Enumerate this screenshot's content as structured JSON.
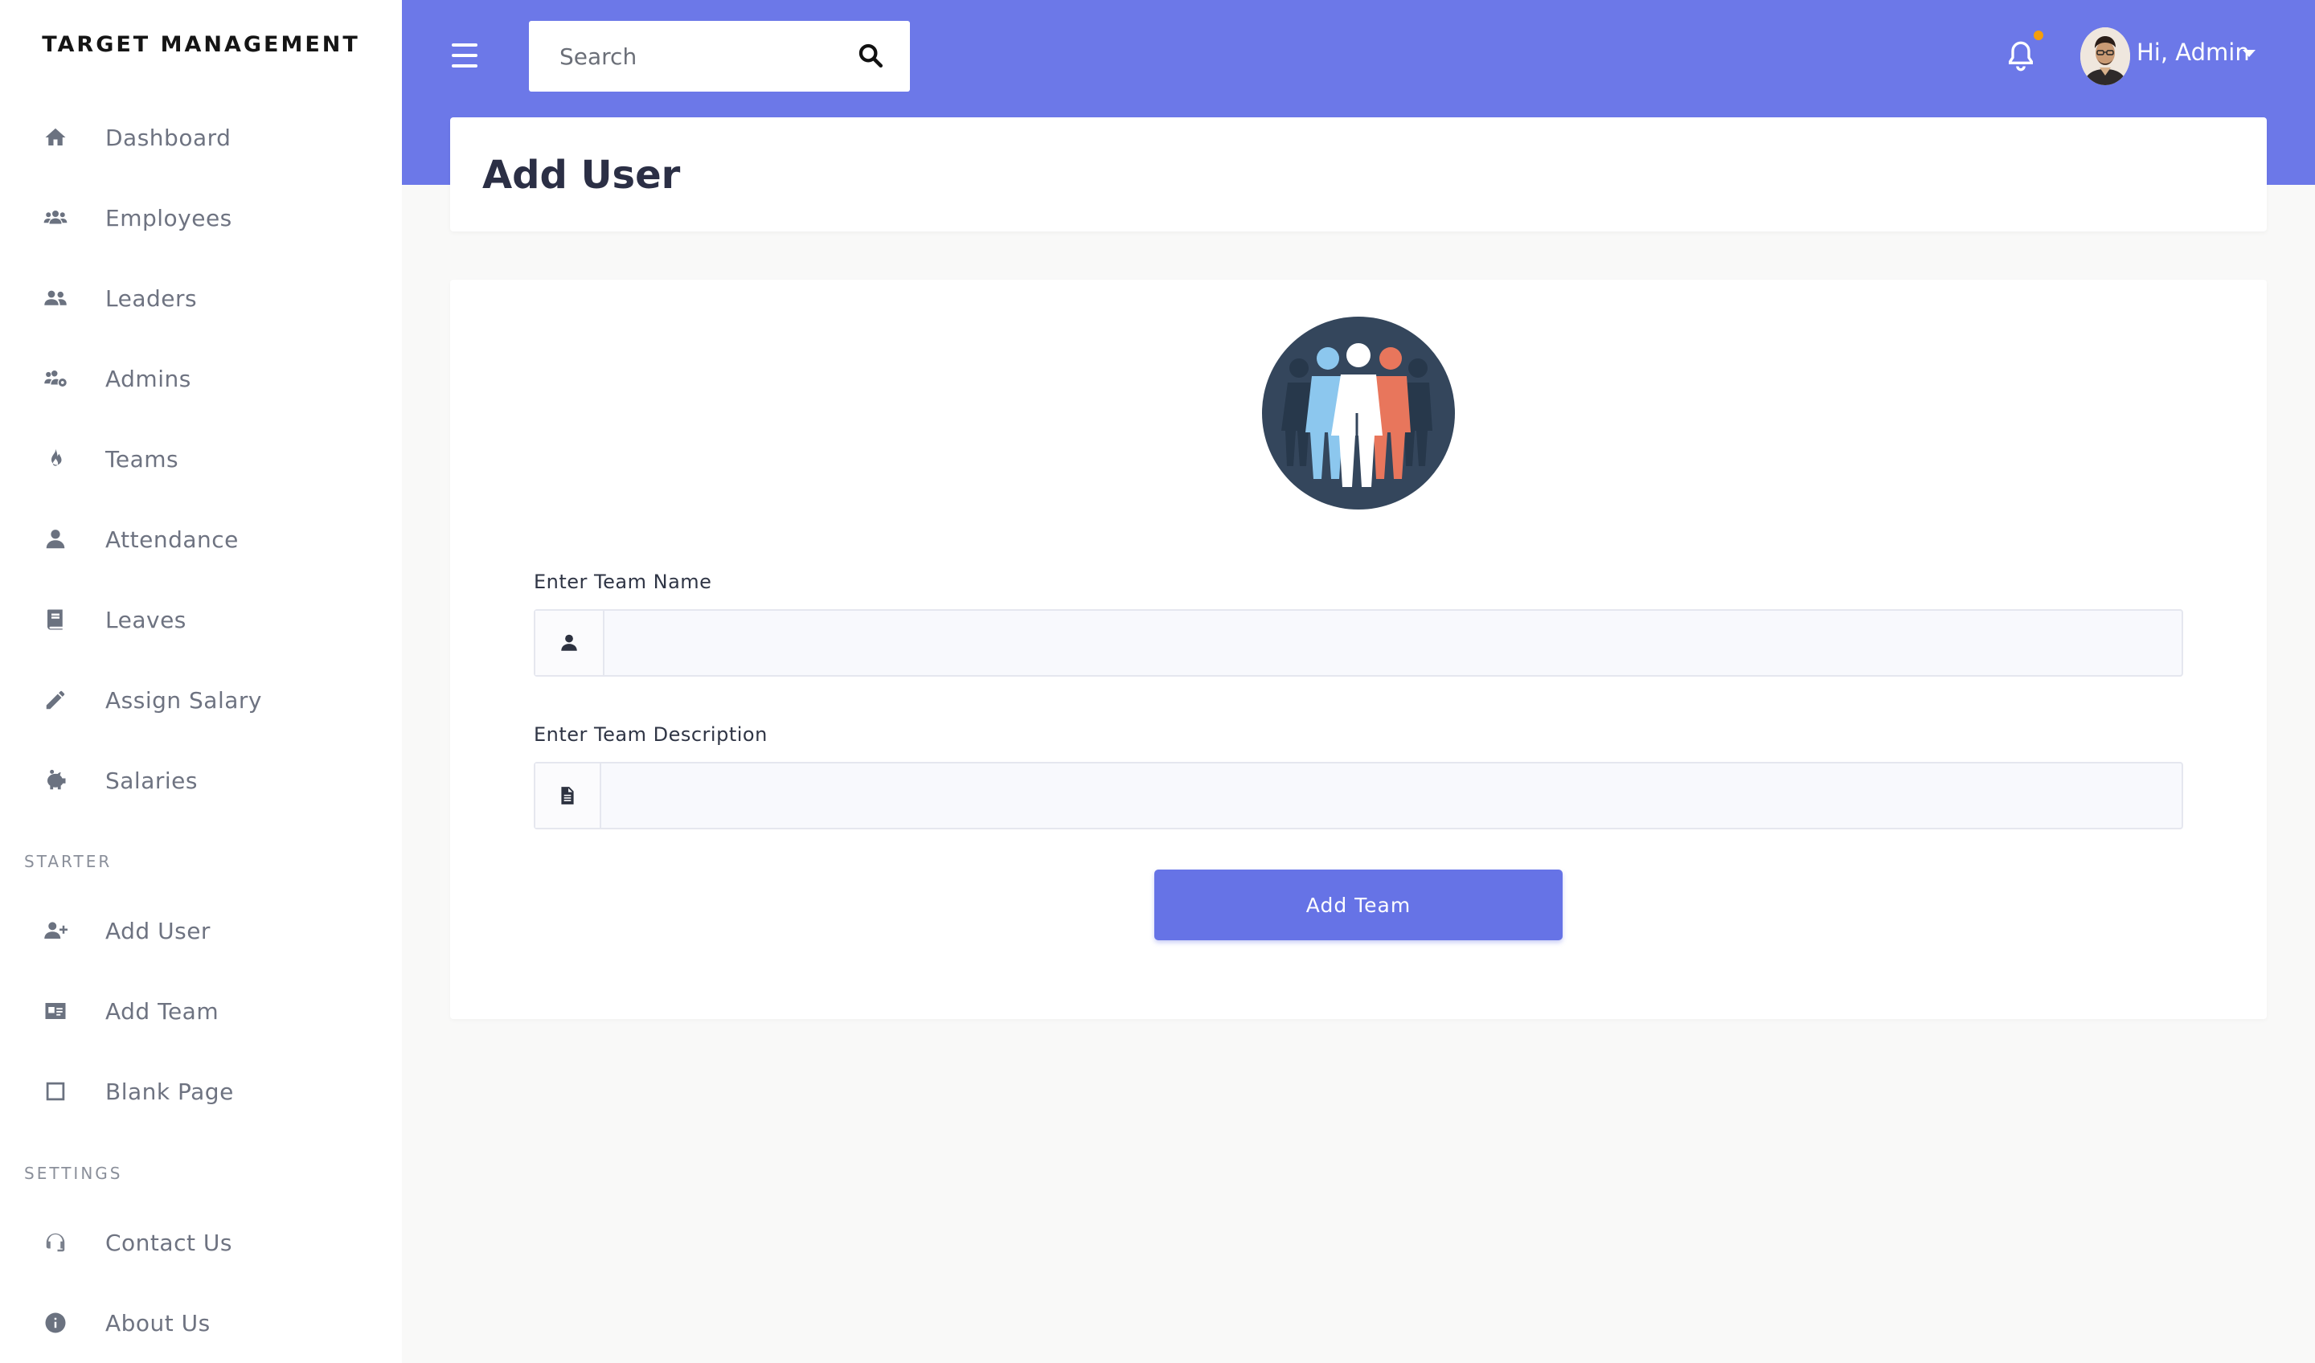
{
  "sidebar": {
    "brand": "TARGET MANAGEMENT",
    "items": [
      {
        "label": "Dashboard",
        "icon": "home-icon"
      },
      {
        "label": "Employees",
        "icon": "users-icon"
      },
      {
        "label": "Leaders",
        "icon": "user-friends-icon"
      },
      {
        "label": "Admins",
        "icon": "users-cog-icon"
      },
      {
        "label": "Teams",
        "icon": "fire-icon"
      },
      {
        "label": "Attendance",
        "icon": "user-icon"
      },
      {
        "label": "Leaves",
        "icon": "book-icon"
      },
      {
        "label": "Assign Salary",
        "icon": "pencil-icon"
      },
      {
        "label": "Salaries",
        "icon": "piggy-bank-icon"
      }
    ],
    "section_starter": "STARTER",
    "starter_items": [
      {
        "label": "Add User",
        "icon": "user-plus-icon"
      },
      {
        "label": "Add Team",
        "icon": "id-card-icon"
      },
      {
        "label": "Blank Page",
        "icon": "square-icon"
      }
    ],
    "section_settings": "SETTINGS",
    "settings_items": [
      {
        "label": "Contact Us",
        "icon": "headset-icon"
      },
      {
        "label": "About Us",
        "icon": "info-circle-icon"
      }
    ]
  },
  "header": {
    "search_placeholder": "Search",
    "user_greeting": "Hi, Admin",
    "accent": "#6c78e8",
    "notification_dot": "#f59e0b"
  },
  "page": {
    "title": "Add User"
  },
  "form": {
    "team_name_label": "Enter Team Name",
    "team_name_value": "",
    "team_description_label": "Enter Team Description",
    "team_description_value": "",
    "submit_label": "Add Team"
  }
}
